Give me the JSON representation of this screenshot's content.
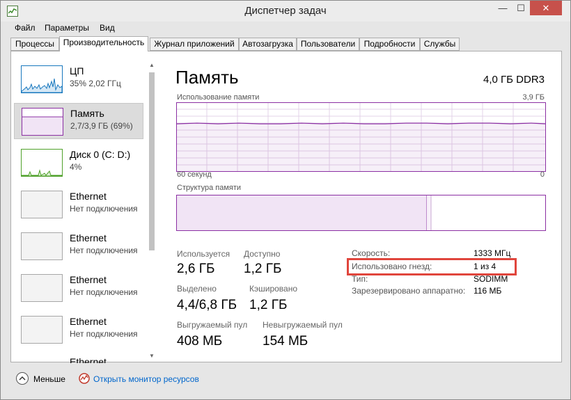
{
  "window": {
    "title": "Диспетчер задач"
  },
  "menu": [
    "Файл",
    "Параметры",
    "Вид"
  ],
  "tabs": [
    "Процессы",
    "Производительность",
    "Журнал приложений",
    "Автозагрузка",
    "Пользователи",
    "Подробности",
    "Службы"
  ],
  "active_tab": "Производительность",
  "sidebar": {
    "items": [
      {
        "title": "ЦП",
        "sub": "35%  2,02 ГГц",
        "color": "#1777be"
      },
      {
        "title": "Память",
        "sub": "2,7/3,9 ГБ (69%)",
        "color": "#8b2fa3"
      },
      {
        "title": "Диск 0 (C: D:)",
        "sub": "4%",
        "color": "#4fa12a"
      },
      {
        "title": "Ethernet",
        "sub": "Нет подключения",
        "color": "#a7a7a7"
      },
      {
        "title": "Ethernet",
        "sub": "Нет подключения",
        "color": "#a7a7a7"
      },
      {
        "title": "Ethernet",
        "sub": "Нет подключения",
        "color": "#a7a7a7"
      },
      {
        "title": "Ethernet",
        "sub": "Нет подключения",
        "color": "#a7a7a7"
      },
      {
        "title": "Ethernet",
        "sub": "",
        "color": "#a7a7a7"
      }
    ]
  },
  "main": {
    "title": "Память",
    "type": "4,0 ГБ DDR3",
    "usage_label": "Использование памяти",
    "usage_max": "3,9 ГБ",
    "time_left": "60 секунд",
    "time_right": "0",
    "composition_label": "Структура памяти",
    "usage_percent": 69,
    "accent": "#8b2fa3"
  },
  "stats": {
    "in_use_label": "Используется",
    "in_use": "2,6 ГБ",
    "available_label": "Доступно",
    "available": "1,2 ГБ",
    "committed_label": "Выделено",
    "committed": "4,4/6,8 ГБ",
    "cached_label": "Кэшировано",
    "cached": "1,2 ГБ",
    "paged_label": "Выгружаемый пул",
    "paged": "408 МБ",
    "nonpaged_label": "Невыгружаемый пул",
    "nonpaged": "154 МБ"
  },
  "info": [
    {
      "label": "Скорость:",
      "value": "1333 МГц"
    },
    {
      "label": "Использовано гнезд:",
      "value": "1 из 4"
    },
    {
      "label": "Тип:",
      "value": "SODIMM"
    },
    {
      "label": "Зарезервировано аппаратно:",
      "value": "116 МБ"
    }
  ],
  "footer": {
    "less": "Меньше",
    "monitor": "Открыть монитор ресурсов"
  }
}
